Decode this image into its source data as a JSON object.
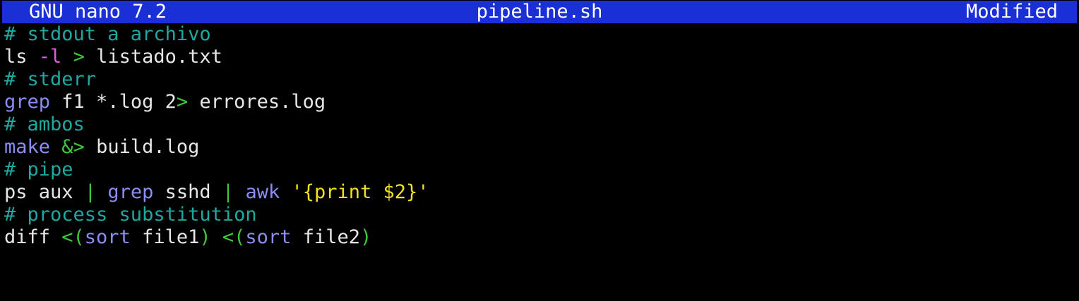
{
  "colors": {
    "titlebar_bg": "#1a2fd6",
    "titlebar_fg": "#ffffff",
    "background": "#000000",
    "plain": "#e6e6e6",
    "comment": "#1fa8a0",
    "keyword": "#8c8cf5",
    "operator": "#3cc83c",
    "flag": "#e060e0",
    "string": "#f0e020"
  },
  "titlebar": {
    "app_name": "GNU nano 7.2",
    "file_name": "pipeline.sh",
    "status": "Modified"
  },
  "lines": [
    [
      {
        "t": "# stdout a archivo",
        "c": "comment"
      }
    ],
    [
      {
        "t": "ls ",
        "c": "plain"
      },
      {
        "t": "-l",
        "c": "flag"
      },
      {
        "t": " ",
        "c": "plain"
      },
      {
        "t": ">",
        "c": "operator"
      },
      {
        "t": " listado.txt",
        "c": "plain"
      }
    ],
    [
      {
        "t": "# stderr",
        "c": "comment"
      }
    ],
    [
      {
        "t": "grep",
        "c": "keyword"
      },
      {
        "t": " f1 *.log 2",
        "c": "plain"
      },
      {
        "t": ">",
        "c": "operator"
      },
      {
        "t": " errores.log",
        "c": "plain"
      }
    ],
    [
      {
        "t": "# ambos",
        "c": "comment"
      }
    ],
    [
      {
        "t": "make",
        "c": "keyword"
      },
      {
        "t": " ",
        "c": "plain"
      },
      {
        "t": "&>",
        "c": "operator"
      },
      {
        "t": " build.log",
        "c": "plain"
      }
    ],
    [
      {
        "t": "# pipe",
        "c": "comment"
      }
    ],
    [
      {
        "t": "ps aux ",
        "c": "plain"
      },
      {
        "t": "|",
        "c": "operator"
      },
      {
        "t": " ",
        "c": "plain"
      },
      {
        "t": "grep",
        "c": "keyword"
      },
      {
        "t": " sshd ",
        "c": "plain"
      },
      {
        "t": "|",
        "c": "operator"
      },
      {
        "t": " ",
        "c": "plain"
      },
      {
        "t": "awk",
        "c": "keyword"
      },
      {
        "t": " ",
        "c": "plain"
      },
      {
        "t": "'{print $2}'",
        "c": "string"
      }
    ],
    [
      {
        "t": "# process substitution",
        "c": "comment"
      }
    ],
    [
      {
        "t": "diff ",
        "c": "plain"
      },
      {
        "t": "<(",
        "c": "operator"
      },
      {
        "t": "sort",
        "c": "keyword"
      },
      {
        "t": " file1",
        "c": "plain"
      },
      {
        "t": ")",
        "c": "operator"
      },
      {
        "t": " ",
        "c": "plain"
      },
      {
        "t": "<(",
        "c": "operator"
      },
      {
        "t": "sort",
        "c": "keyword"
      },
      {
        "t": " file2",
        "c": "plain"
      },
      {
        "t": ")",
        "c": "operator"
      }
    ]
  ]
}
